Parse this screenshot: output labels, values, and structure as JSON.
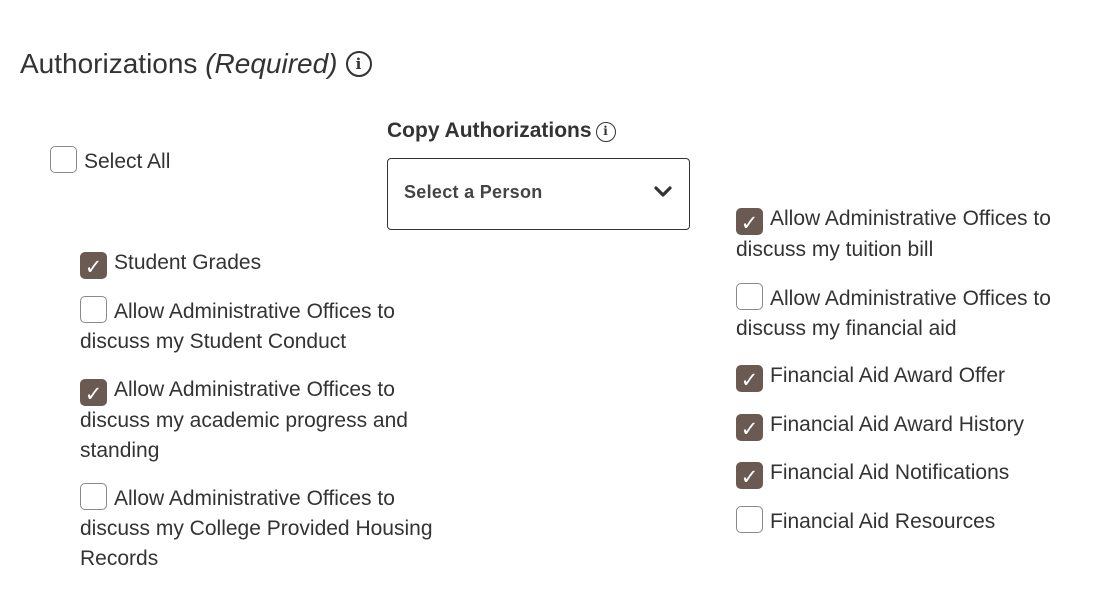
{
  "header": {
    "title": "Authorizations",
    "required": "(Required)",
    "info_icon": "info-icon"
  },
  "select_all": {
    "label": "Select All",
    "checked": false
  },
  "copy": {
    "label": "Copy Authorizations",
    "info_icon": "info-icon",
    "select_value": "Select a Person",
    "chevron_icon": "chevron-down-icon"
  },
  "colors": {
    "checked_fill": "#6b5a52",
    "text": "#333333",
    "border": "#8a8a8a"
  },
  "left_options": [
    {
      "label": "Student Grades",
      "checked": true
    },
    {
      "label": "Allow Administrative Offices to discuss my Student Conduct",
      "checked": false
    },
    {
      "label": "Allow Administrative Offices to discuss my academic progress and standing",
      "checked": true
    },
    {
      "label": "Allow Administrative Offices to discuss my College Provided Housing Records",
      "checked": false
    }
  ],
  "right_options": [
    {
      "label": "Allow Administrative Offices to discuss my tuition bill",
      "checked": true
    },
    {
      "label": "Allow Administrative Offices to discuss my financial aid",
      "checked": false
    },
    {
      "label": "Financial Aid Award Offer",
      "checked": true
    },
    {
      "label": "Financial Aid Award History",
      "checked": true
    },
    {
      "label": "Financial Aid Notifications",
      "checked": true
    },
    {
      "label": "Financial Aid Resources",
      "checked": false
    }
  ]
}
